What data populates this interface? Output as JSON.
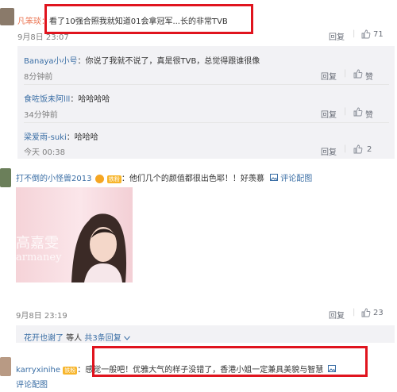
{
  "c1": {
    "author": "凡笨琰：",
    "text": "看了10强合照我就知道01会拿冠军...长的非常TVB",
    "time": "9月8日 23:07",
    "reply": "回复",
    "likes": "71"
  },
  "replies": [
    {
      "author": "Banaya小小号",
      "text": "：你说了我就不说了，真是很TVB，总觉得跟谁很像",
      "time": "8分钟前",
      "reply": "回复",
      "like": "赞"
    },
    {
      "author": "食咗饭未阿lll",
      "text": "：哈哈哈哈",
      "time": "34分钟前",
      "reply": "回复",
      "like": "赞"
    },
    {
      "author": "梁爱雨-suki",
      "text": "：哈哈哈",
      "time": "今天 00:38",
      "reply": "回复",
      "likes": "2"
    }
  ],
  "c2": {
    "author": "打不倒的小怪兽2013",
    "badge": "铁粉",
    "text": "：他们几个的颜值都很出色耶！！好羡慕",
    "comment_pic": "评论配图",
    "watermark_big": "高嘉雯",
    "watermark_small": "armaney",
    "time": "9月8日 23:19",
    "reply": "回复",
    "likes": "23",
    "sub_author": "花开也谢了",
    "sub_text": " 等人 ",
    "sub_count": "共3条回复"
  },
  "c3": {
    "author": "karryxinihe",
    "badge": "铁粉",
    "text": "：感觉一般吧！优雅大气的样子没错了，香港小姐一定兼具美貌与智慧",
    "comment_pic": "评论配图"
  },
  "colors": {
    "link": "#eb7350",
    "highlight": "#e0141e",
    "name": "#3a6ea5"
  }
}
